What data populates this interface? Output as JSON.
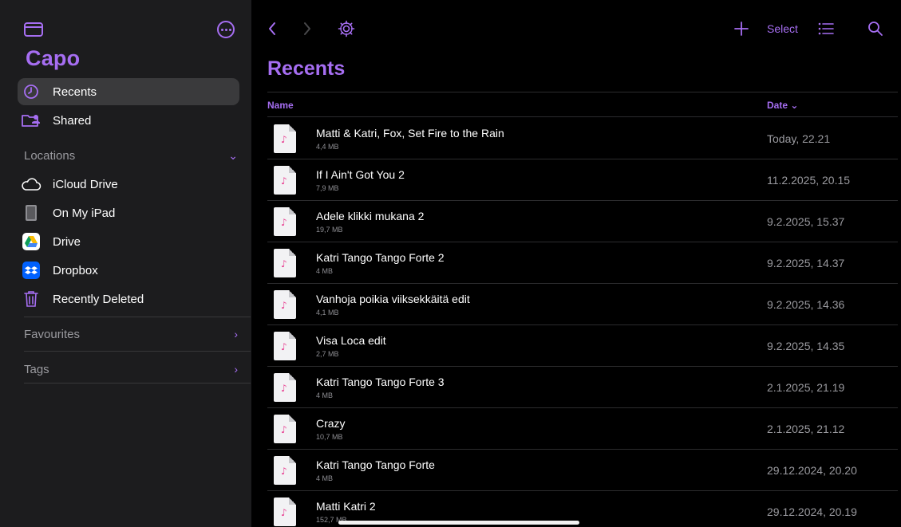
{
  "app": {
    "title": "Capo",
    "accent_color": "#a66ef2"
  },
  "sidebar": {
    "items": [
      {
        "label": "Recents",
        "icon": "clock-icon",
        "active": true
      },
      {
        "label": "Shared",
        "icon": "shared-folder-icon"
      }
    ],
    "locations": {
      "label": "Locations",
      "items": [
        {
          "label": "iCloud Drive",
          "icon": "cloud-icon"
        },
        {
          "label": "On My iPad",
          "icon": "ipad-icon"
        },
        {
          "label": "Drive",
          "icon": "google-drive-icon"
        },
        {
          "label": "Dropbox",
          "icon": "dropbox-icon"
        },
        {
          "label": "Recently Deleted",
          "icon": "trash-icon"
        }
      ]
    },
    "favourites_label": "Favourites",
    "tags_label": "Tags"
  },
  "toolbar": {
    "select_label": "Select"
  },
  "main": {
    "title": "Recents",
    "columns": {
      "name": "Name",
      "date": "Date ⌄"
    },
    "files": [
      {
        "name": "Matti & Katri, Fox, Set Fire to the Rain",
        "size": "4,4 MB",
        "date": "Today, 22.21"
      },
      {
        "name": "If I Ain't Got You 2",
        "size": "7,9 MB",
        "date": "11.2.2025, 20.15"
      },
      {
        "name": "Adele klikki mukana 2",
        "size": "19,7 MB",
        "date": "9.2.2025, 15.37"
      },
      {
        "name": "Katri Tango Tango Forte 2",
        "size": "4 MB",
        "date": "9.2.2025, 14.37"
      },
      {
        "name": "Vanhoja poikia viiksekkäitä edit",
        "size": "4,1 MB",
        "date": "9.2.2025, 14.36"
      },
      {
        "name": "Visa Loca edit",
        "size": "2,7 MB",
        "date": "9.2.2025, 14.35"
      },
      {
        "name": "Katri Tango Tango Forte 3",
        "size": "4 MB",
        "date": "2.1.2025, 21.19"
      },
      {
        "name": "Crazy",
        "size": "10,7 MB",
        "date": "2.1.2025, 21.12"
      },
      {
        "name": "Katri Tango Tango Forte",
        "size": "4 MB",
        "date": "29.12.2024, 20.20"
      },
      {
        "name": "Matti Katri 2",
        "size": "152,7 MB",
        "date": "29.12.2024, 20.19"
      }
    ]
  }
}
